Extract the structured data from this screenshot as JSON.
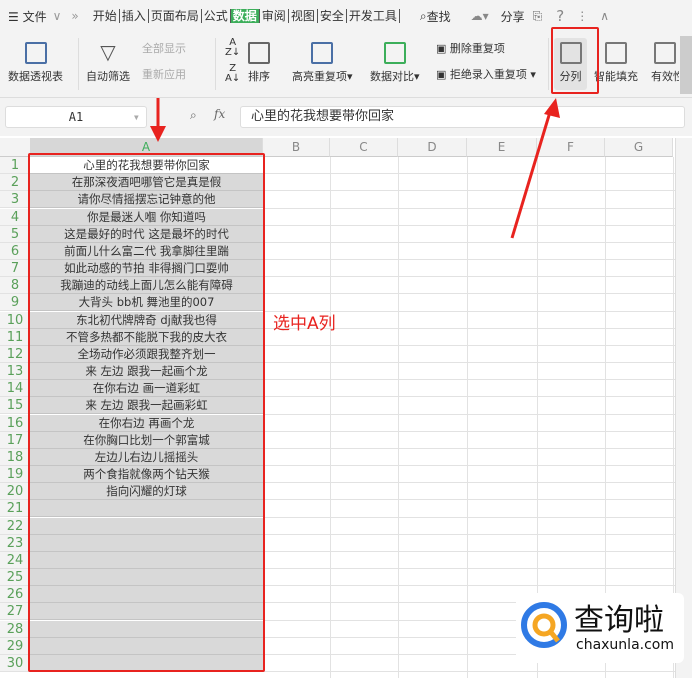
{
  "topbar": {
    "menu": "☰ 文件",
    "more": "»",
    "tabs": [
      "开始",
      "插入",
      "页面布局",
      "公式",
      "数据",
      "审阅",
      "视图",
      "安全",
      "开发工具"
    ],
    "active_tab": "数据",
    "search": "查找",
    "share": "分享",
    "help": "?"
  },
  "ribbon": {
    "pivot": "数据透视表",
    "autofilter": "自动筛选",
    "show_all": "全部显示",
    "reapply": "重新应用",
    "sort": "排序",
    "highlight_dup": "高亮重复项",
    "compare": "数据对比",
    "remove_dup": "删除重复项",
    "reject_dup": "拒绝录入重复项",
    "split": "分列",
    "smart_fill": "智能填充",
    "validity": "有效性"
  },
  "formula_bar": {
    "name_box": "A1",
    "fx": "fx",
    "value": "心里的花我想要带你回家"
  },
  "columns": [
    "A",
    "B",
    "C",
    "D",
    "E",
    "F",
    "G"
  ],
  "rows": [
    "心里的花我想要带你回家",
    "在那深夜酒吧哪管它是真是假",
    "请你尽情摇摆忘记钟意的他",
    "你是最迷人嗰 你知道吗",
    "这是最好的时代 这是最坏的时代",
    "前面儿什么富二代 我拿脚往里踹",
    "如此动感的节拍 非得搁门口耍帅",
    "我蹦迪的动线上面儿怎么能有障碍",
    "大背头 bb机 舞池里的007",
    "东北初代牌牌奇 dj献我也得",
    "不管多热都不能脱下我的皮大衣",
    "全场动作必须跟我整齐划一",
    "来 左边 跟我一起画个龙",
    "在你右边 画一道彩虹",
    "来 左边 跟我一起画彩虹",
    "在你右边 再画个龙",
    "在你胸口比划一个郭富城",
    "左边儿右边儿摇摇头",
    "两个食指就像两个钻天猴",
    "指向闪耀的灯球",
    "",
    "",
    "",
    "",
    "",
    "",
    "",
    "",
    "",
    ""
  ],
  "annotation": "选中A列",
  "watermark": {
    "name": "查询啦",
    "url": "chaxunla.com"
  },
  "colors": {
    "accent": "#3cae5a",
    "annotation": "#e8231f"
  }
}
